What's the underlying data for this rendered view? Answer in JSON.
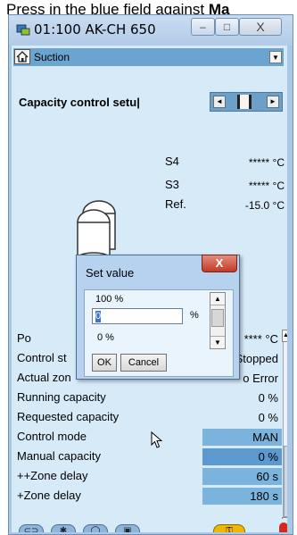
{
  "caption": {
    "prefix": "Press in the blue field against ",
    "bold": "Ma"
  },
  "window": {
    "title": "01:100 AK-CH 650",
    "buttons": {
      "minimize": "–",
      "maximize": "□",
      "close": "X"
    }
  },
  "crumb": {
    "label": "Suction"
  },
  "section": {
    "title": "Capacity control setu|"
  },
  "measurements": [
    {
      "label": "S4",
      "value": "***** °C"
    },
    {
      "label": "S3",
      "value": "***** °C"
    },
    {
      "label": "Ref.",
      "value": "-15.0 °C"
    }
  ],
  "rows": [
    {
      "label": "Po",
      "value": "**** °C",
      "style": "none"
    },
    {
      "label": "Control st",
      "value": "Stopped",
      "style": "none"
    },
    {
      "label": "Actual zon",
      "value": "o Error",
      "style": "none"
    },
    {
      "label": "Running capacity",
      "value": "0 %",
      "style": "none"
    },
    {
      "label": "Requested capacity",
      "value": "0 %",
      "style": "none"
    },
    {
      "label": "Control mode",
      "value": "MAN",
      "style": "blue"
    },
    {
      "label": "Manual capacity",
      "value": "0 %",
      "style": "dark"
    },
    {
      "label": "++Zone delay",
      "value": "60 s",
      "style": "blue"
    },
    {
      "label": "+Zone delay",
      "value": "180 s",
      "style": "blue"
    }
  ],
  "dialog": {
    "title": "Set value",
    "close": "X",
    "max": "100 %",
    "input_value": "0",
    "unit": "%",
    "min": "0 %",
    "ok": "OK",
    "cancel": "Cancel"
  },
  "colors": {
    "client_bg": "#d6eaf8",
    "value_field": "#7ab4dd",
    "selected_field": "#5d98cf",
    "dialog_close": "#c33b26"
  },
  "bottom_icons": [
    "compressor-group-icon",
    "fan-icon",
    "condenser-icon",
    "camera-icon",
    "key-icon",
    "alarm-icon"
  ]
}
